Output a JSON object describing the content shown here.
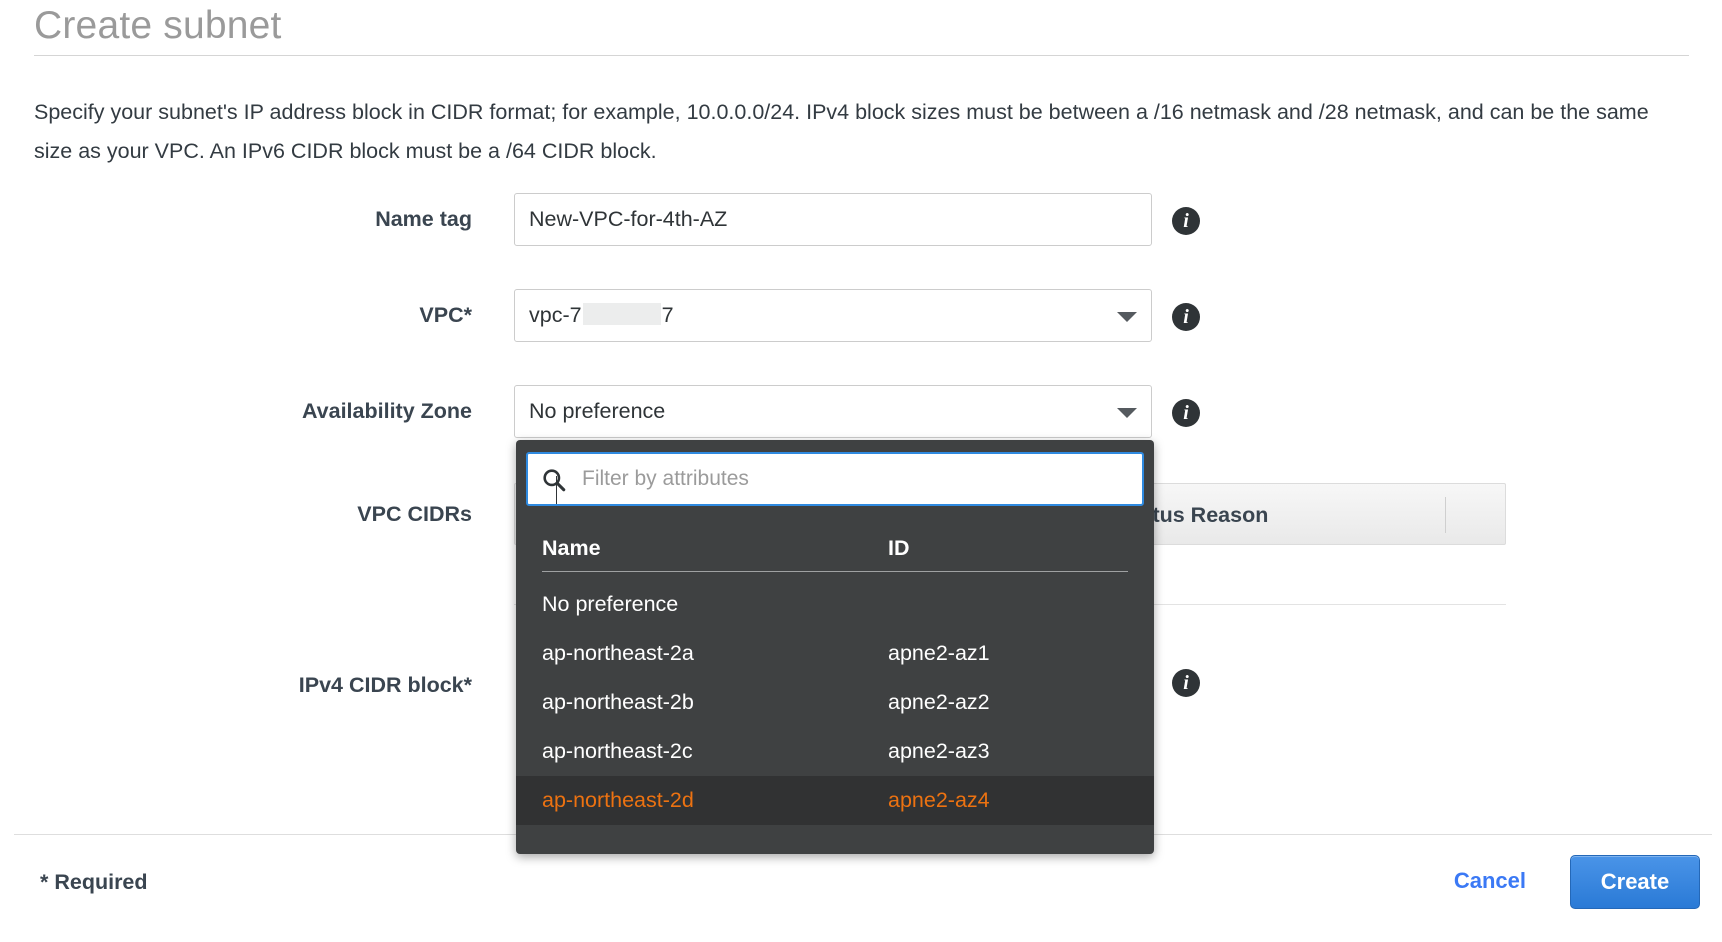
{
  "dialog": {
    "title": "Create subnet",
    "description": "Specify your subnet's IP address block in CIDR format; for example, 10.0.0.0/24. IPv4 block sizes must be between a /16 netmask and /28 netmask, and can be the same size as your VPC. An IPv6 CIDR block must be a /64 CIDR block."
  },
  "form": {
    "name_tag": {
      "label": "Name tag",
      "value": "New-VPC-for-4th-AZ",
      "info_icon": "info-icon"
    },
    "vpc": {
      "label": "VPC*",
      "value_prefix": "vpc-7",
      "value_suffix": "7",
      "caret_icon": "chevron-down-icon",
      "info_icon": "info-icon"
    },
    "availability_zone": {
      "label": "Availability Zone",
      "value": "No preference",
      "caret_icon": "chevron-down-icon",
      "info_icon": "info-icon"
    },
    "vpc_cidrs": {
      "label": "VPC CIDRs",
      "columns": [
        "Status Reason"
      ]
    },
    "ipv4_cidr_block": {
      "label": "IPv4 CIDR block*",
      "info_icon": "info-icon"
    }
  },
  "dropdown": {
    "search_icon": "search-icon",
    "filter_placeholder": "Filter by attributes",
    "filter_value": "",
    "columns": {
      "name": "Name",
      "id": "ID"
    },
    "items": [
      {
        "name": "No preference",
        "id": "",
        "selected": false
      },
      {
        "name": "ap-northeast-2a",
        "id": "apne2-az1",
        "selected": false
      },
      {
        "name": "ap-northeast-2b",
        "id": "apne2-az2",
        "selected": false
      },
      {
        "name": "ap-northeast-2c",
        "id": "apne2-az3",
        "selected": false
      },
      {
        "name": "ap-northeast-2d",
        "id": "apne2-az4",
        "selected": true
      }
    ]
  },
  "footer": {
    "required_note": "* Required",
    "cancel_label": "Cancel",
    "create_label": "Create"
  },
  "colors": {
    "accent_orange": "#ec7211",
    "link_blue": "#3b79f5",
    "button_blue": "#2a7ad6",
    "panel_dark": "#3f4142",
    "focus_blue": "#2f8ae0"
  }
}
